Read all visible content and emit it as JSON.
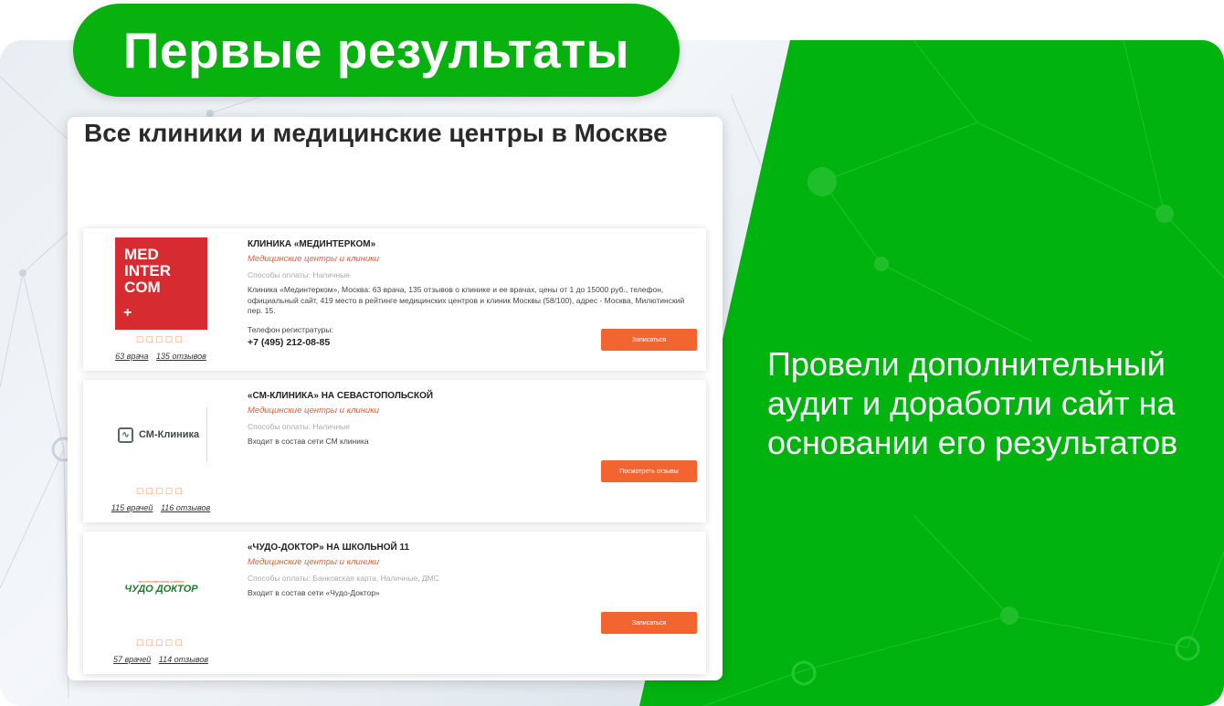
{
  "headline": "Первые результаты",
  "card": {
    "title": "Все клиники и медицинские центры в Москве",
    "clinics": [
      {
        "logo_lines": [
          "MED",
          "INTER",
          "COM"
        ],
        "logo_plus": "+",
        "stars": "□□□□□",
        "doctors": "63 врача",
        "reviews": "135 отзывов",
        "name": "КЛИНИКА «МЕДИНТЕРКОМ»",
        "category": "Медицинские центры и клиники",
        "payment": "Способы оплаты: Наличные",
        "description": "Клиника «Мединтерком», Москва: 63 врача, 135 отзывов о клинике и ее врачах, цены от 1 до 15000 руб., телефон, официальный сайт, 419 место в рейтинге медицинских центров и клиник Москвы (58/100), адрес - Москва, Милютинский пер. 15.",
        "phone_label": "Телефон регистратуры:",
        "phone": "+7 (495) 212-08-85",
        "button": "Записаться"
      },
      {
        "logo_text": "СМ-Клиника",
        "stars": "□□□□□",
        "doctors": "115 врачей",
        "reviews": "116 отзывов",
        "name": "«СМ-КЛИНИКА» НА СЕВАСТОПОЛЬСКОЙ",
        "category": "Медицинские центры и клиники",
        "payment": "Способы оплаты: Наличные",
        "description": "Входит в состав сети СМ клиника",
        "button": "Посмотреть отзывы"
      },
      {
        "logo_text": "ЧУДО ДОКТОР",
        "logo_subtext": "многопрофильная клиника",
        "stars": "□□□□□",
        "doctors": "57 врачей",
        "reviews": "114 отзывов",
        "name": "«ЧУДО-ДОКТОР» НА ШКОЛЬНОЙ 11",
        "category": "Медицинские центры и клиники",
        "payment": "Способы оплаты: Банковская карта, Наличные, ДМС",
        "description": "Входит в состав сети «Чудо-Доктор»",
        "button": "Записаться"
      }
    ]
  },
  "right_text": "Провели дополнительный аудит и доработли сайт на основании его результатов",
  "colors": {
    "green": "#00b30f",
    "orange": "#f26430",
    "logo_red": "#d52b31"
  }
}
